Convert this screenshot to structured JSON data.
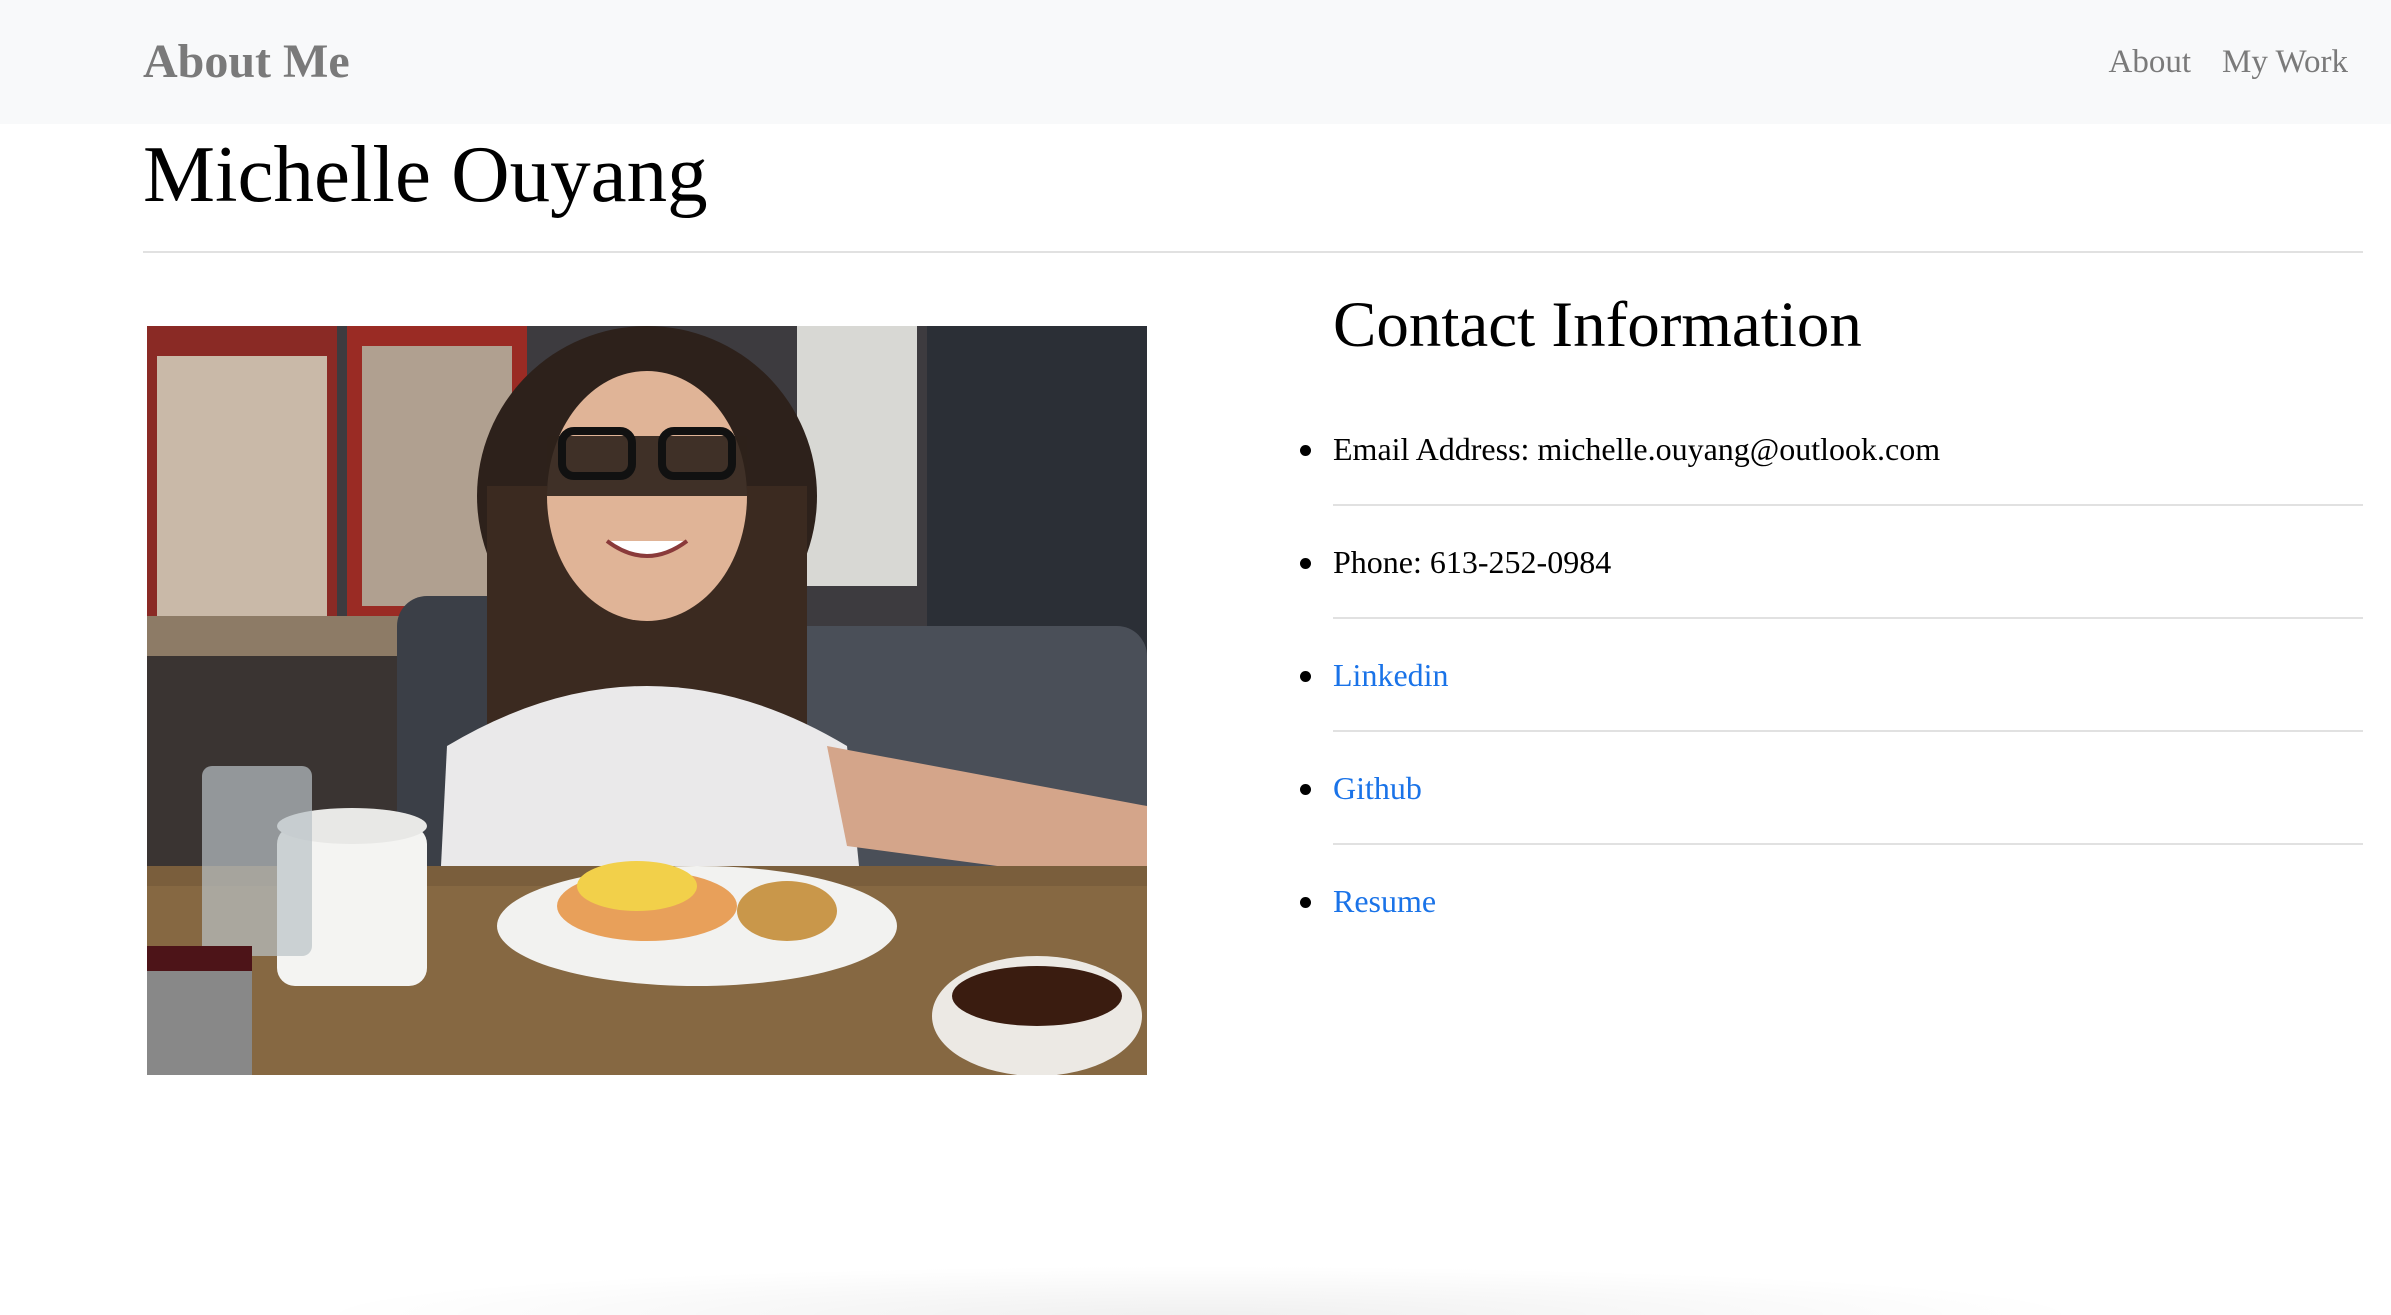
{
  "navbar": {
    "brand": "About Me",
    "links": [
      {
        "label": "About"
      },
      {
        "label": "My Work"
      }
    ]
  },
  "page": {
    "title": "Michelle Ouyang"
  },
  "photo": {
    "subject": "portrait-photo"
  },
  "contact": {
    "heading": "Contact Information",
    "items": [
      {
        "label": "Email Address: michelle.ouyang@outlook.com"
      },
      {
        "label": "Phone: 613-252-0984"
      },
      {
        "label": "Linkedin"
      },
      {
        "label": "Github"
      },
      {
        "label": "Resume"
      }
    ]
  },
  "colors": {
    "navbar_bg": "#f8f9fa",
    "nav_text": "#7a7a7a",
    "link": "#1a73e8",
    "rule": "#e1e1e1"
  }
}
